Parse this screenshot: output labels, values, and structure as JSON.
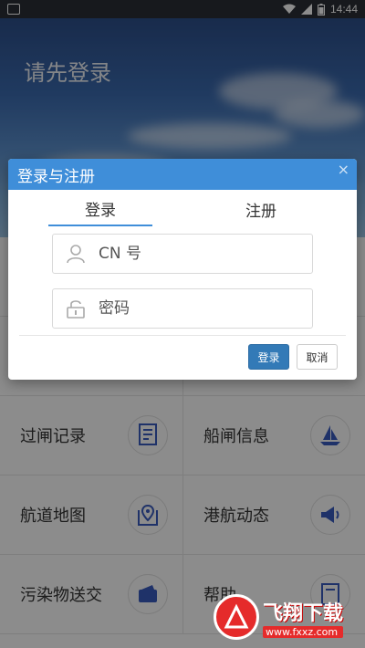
{
  "status_bar": {
    "time": "14:44"
  },
  "header": {
    "title": "请先登录"
  },
  "grid": {
    "items": [
      {
        "label": "过闸记录",
        "icon": "receipt-icon"
      },
      {
        "label": "船闸信息",
        "icon": "sailboat-icon"
      },
      {
        "label": "航道地图",
        "icon": "map-pin-icon"
      },
      {
        "label": "港航动态",
        "icon": "megaphone-icon"
      },
      {
        "label": "污染物送交",
        "icon": "wallet-icon"
      },
      {
        "label": "帮助",
        "icon": "document-icon"
      }
    ]
  },
  "dialog": {
    "title": "登录与注册",
    "close": "×",
    "tabs": [
      "登录",
      "注册"
    ],
    "active_tab": "登录",
    "cn_placeholder": "CN 号",
    "password_placeholder": "密码",
    "login_button": "登录",
    "cancel_button": "取消"
  },
  "watermark": {
    "text": "飞翔下载",
    "site": "www.fxxz.com"
  },
  "colors": {
    "accent": "#3f8ed9",
    "login_button": "#337ab7",
    "icon_blue": "#3a5bbf"
  }
}
